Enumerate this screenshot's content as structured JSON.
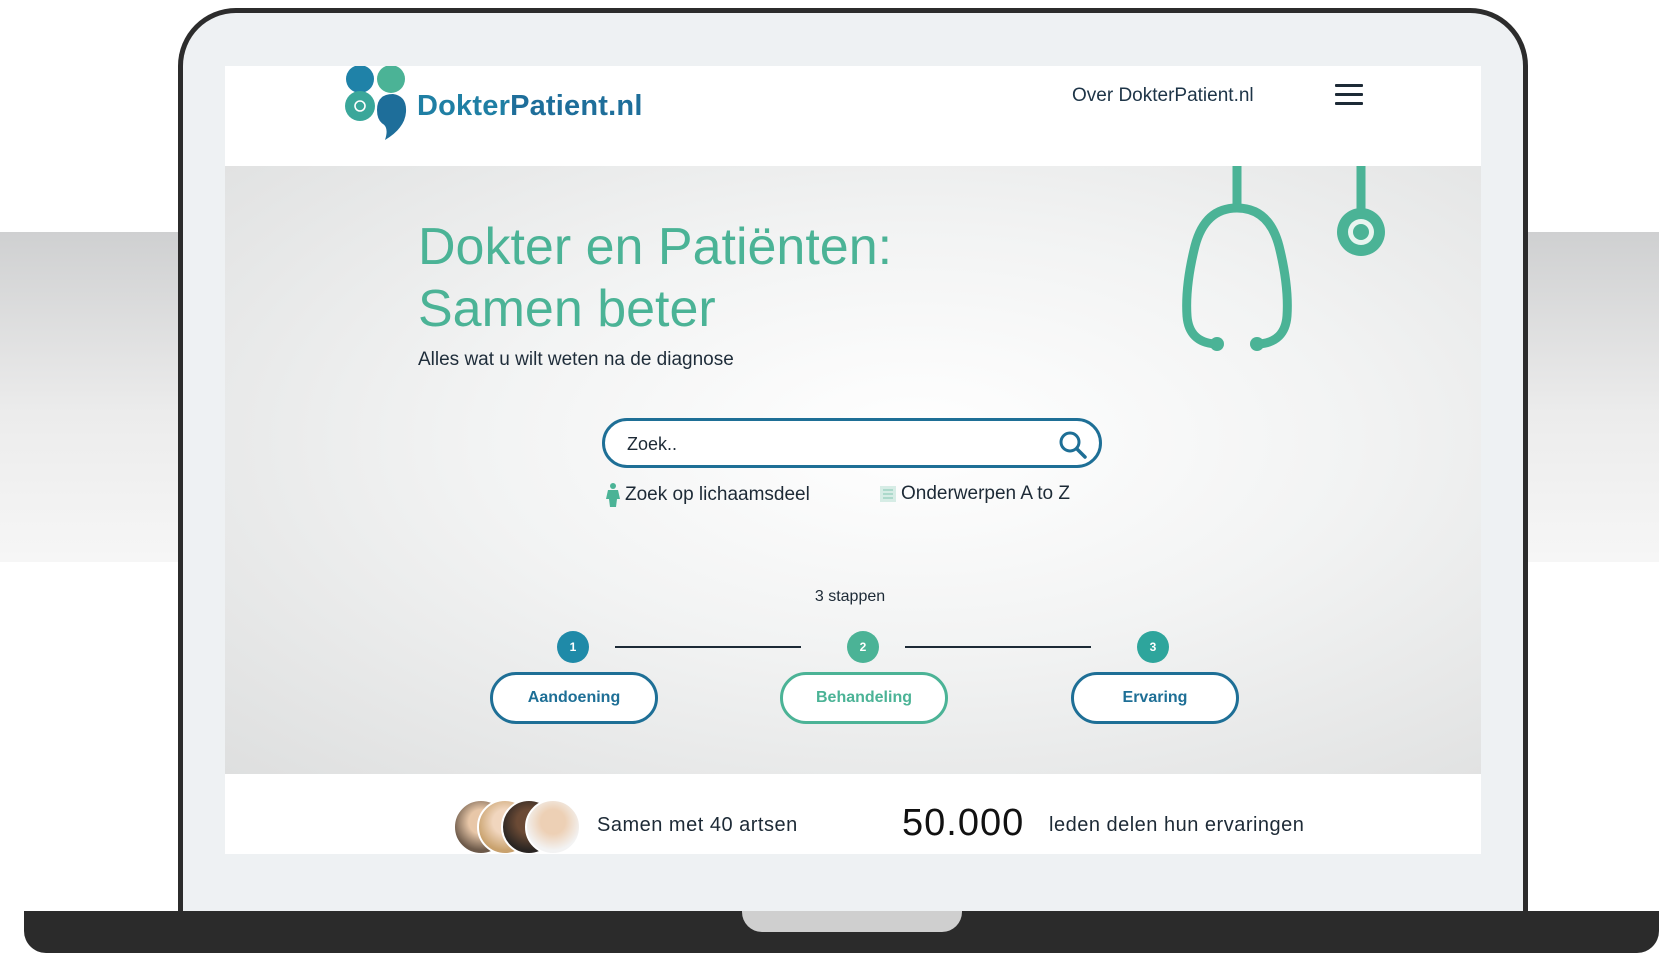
{
  "brand": {
    "name_part1": "Dokter",
    "name_part2": "Patient.nl"
  },
  "nav": {
    "about_label": "Over DokterPatient.nl"
  },
  "hero": {
    "title_line1": "Dokter en Patiënten:",
    "title_line2": "Samen beter",
    "subtitle": "Alles wat u wilt weten na de diagnose"
  },
  "search": {
    "placeholder": "Zoek.."
  },
  "quick_links": {
    "body_part": "Zoek op lichaamsdeel",
    "topics": "Onderwerpen A to Z"
  },
  "steps": {
    "title": "3 stappen",
    "items": [
      {
        "number": "1",
        "label": "Aandoening"
      },
      {
        "number": "2",
        "label": "Behandeling"
      },
      {
        "number": "3",
        "label": "Ervaring"
      }
    ]
  },
  "stats": {
    "doctors_text": "Samen met 40 artsen",
    "members_count": "50.000",
    "members_text": "leden delen hun ervaringen"
  },
  "colors": {
    "teal": "#4bb396",
    "blue": "#1e6f96",
    "dark_teal_step": "#1f8aa8"
  },
  "icons": [
    "menu-icon",
    "search-icon",
    "body-figure-icon",
    "list-icon",
    "stethoscope-icon"
  ]
}
